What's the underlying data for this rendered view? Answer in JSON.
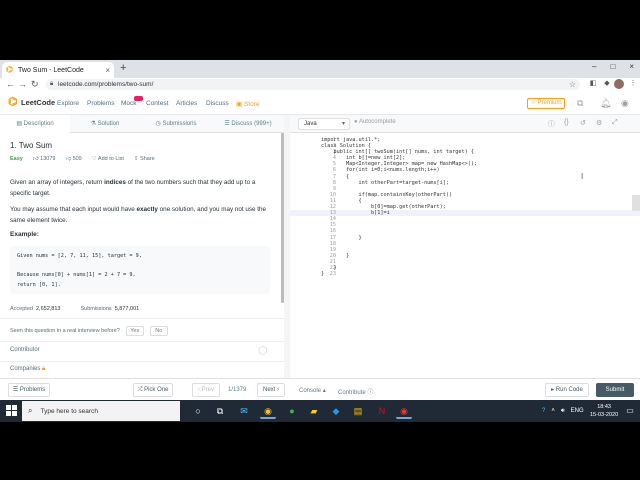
{
  "browser": {
    "tab_title": "Two Sum - LeetCode",
    "tab_close": "×",
    "new_tab": "+",
    "win_controls": [
      "–",
      "□",
      "×"
    ],
    "url": "leetcode.com/problems/two-sum/"
  },
  "lc_nav": {
    "logo_text": "LeetCode",
    "links": [
      "Explore",
      "Problems",
      "Mock",
      "Contest",
      "Articles",
      "Discuss",
      "Store"
    ],
    "premium": "Premium"
  },
  "left_tabs": [
    "Description",
    "Solution",
    "Submissions",
    "Discuss (999+)"
  ],
  "problem": {
    "title": "1. Two Sum",
    "difficulty": "Easy",
    "likes": "13079",
    "dislikes": "509",
    "add_to_list": "Add to List",
    "share": "Share",
    "para1_a": "Given an array of integers, return ",
    "para1_b": "indices",
    "para1_c": " of the two numbers such that they add up to a specific target.",
    "para2_a": "You may assume that each input would have ",
    "para2_b": "exactly",
    "para2_c": " one solution, and you may not use the same element twice.",
    "example_heading": "Example:",
    "example_text": "Given nums = [2, 7, 11, 15], target = 9,\n\nBecause nums[0] + nums[1] = 2 + 7 = 9,\nreturn [0, 1].",
    "accepted_label": "Accepted",
    "accepted_value": "2,652,813",
    "submissions_label": "Submissions",
    "submissions_value": "5,877,001",
    "interview_q": "Seen this question in a real interview before?",
    "yes": "Yes",
    "no": "No",
    "contributor": "Contributor",
    "companies": "Companies"
  },
  "editor": {
    "language": "Java",
    "autocomplete": "Autocomplete",
    "lines": [
      "import java.util.*;",
      "class Solution {",
      "    public int[] twoSum(int[] nums, int target) {",
      "        int b[]=new int[2];",
      "        Map<Integer,Integer> map= new HashMap<>();",
      "        for(int i=0;i<nums.length;i++)",
      "        {",
      "            int otherPart=target-nums[i];",
      "",
      "            if(map.containsKey(otherPart))",
      "            {",
      "                b[0]=map.get(otherPart);",
      "                b[1]=i",
      "",
      "",
      "",
      "            }",
      "",
      "",
      "        }",
      "",
      "    }",
      "}"
    ],
    "current_line": 12
  },
  "actions": {
    "problems": "Problems",
    "pick_one": "Pick One",
    "prev": "Prev",
    "page": "1/1379",
    "next": "Next",
    "console": "Console",
    "contribute": "Contribute",
    "run_code": "Run Code",
    "submit": "Submit"
  },
  "taskbar": {
    "search_placeholder": "Type here to search",
    "lang": "ENG",
    "time": "18:43",
    "date": "15-03-2020"
  },
  "colors": {
    "accent": "#f89f1b",
    "submit_bg": "#455a64",
    "easy": "#43a047",
    "taskbar": "#1f2a36"
  }
}
